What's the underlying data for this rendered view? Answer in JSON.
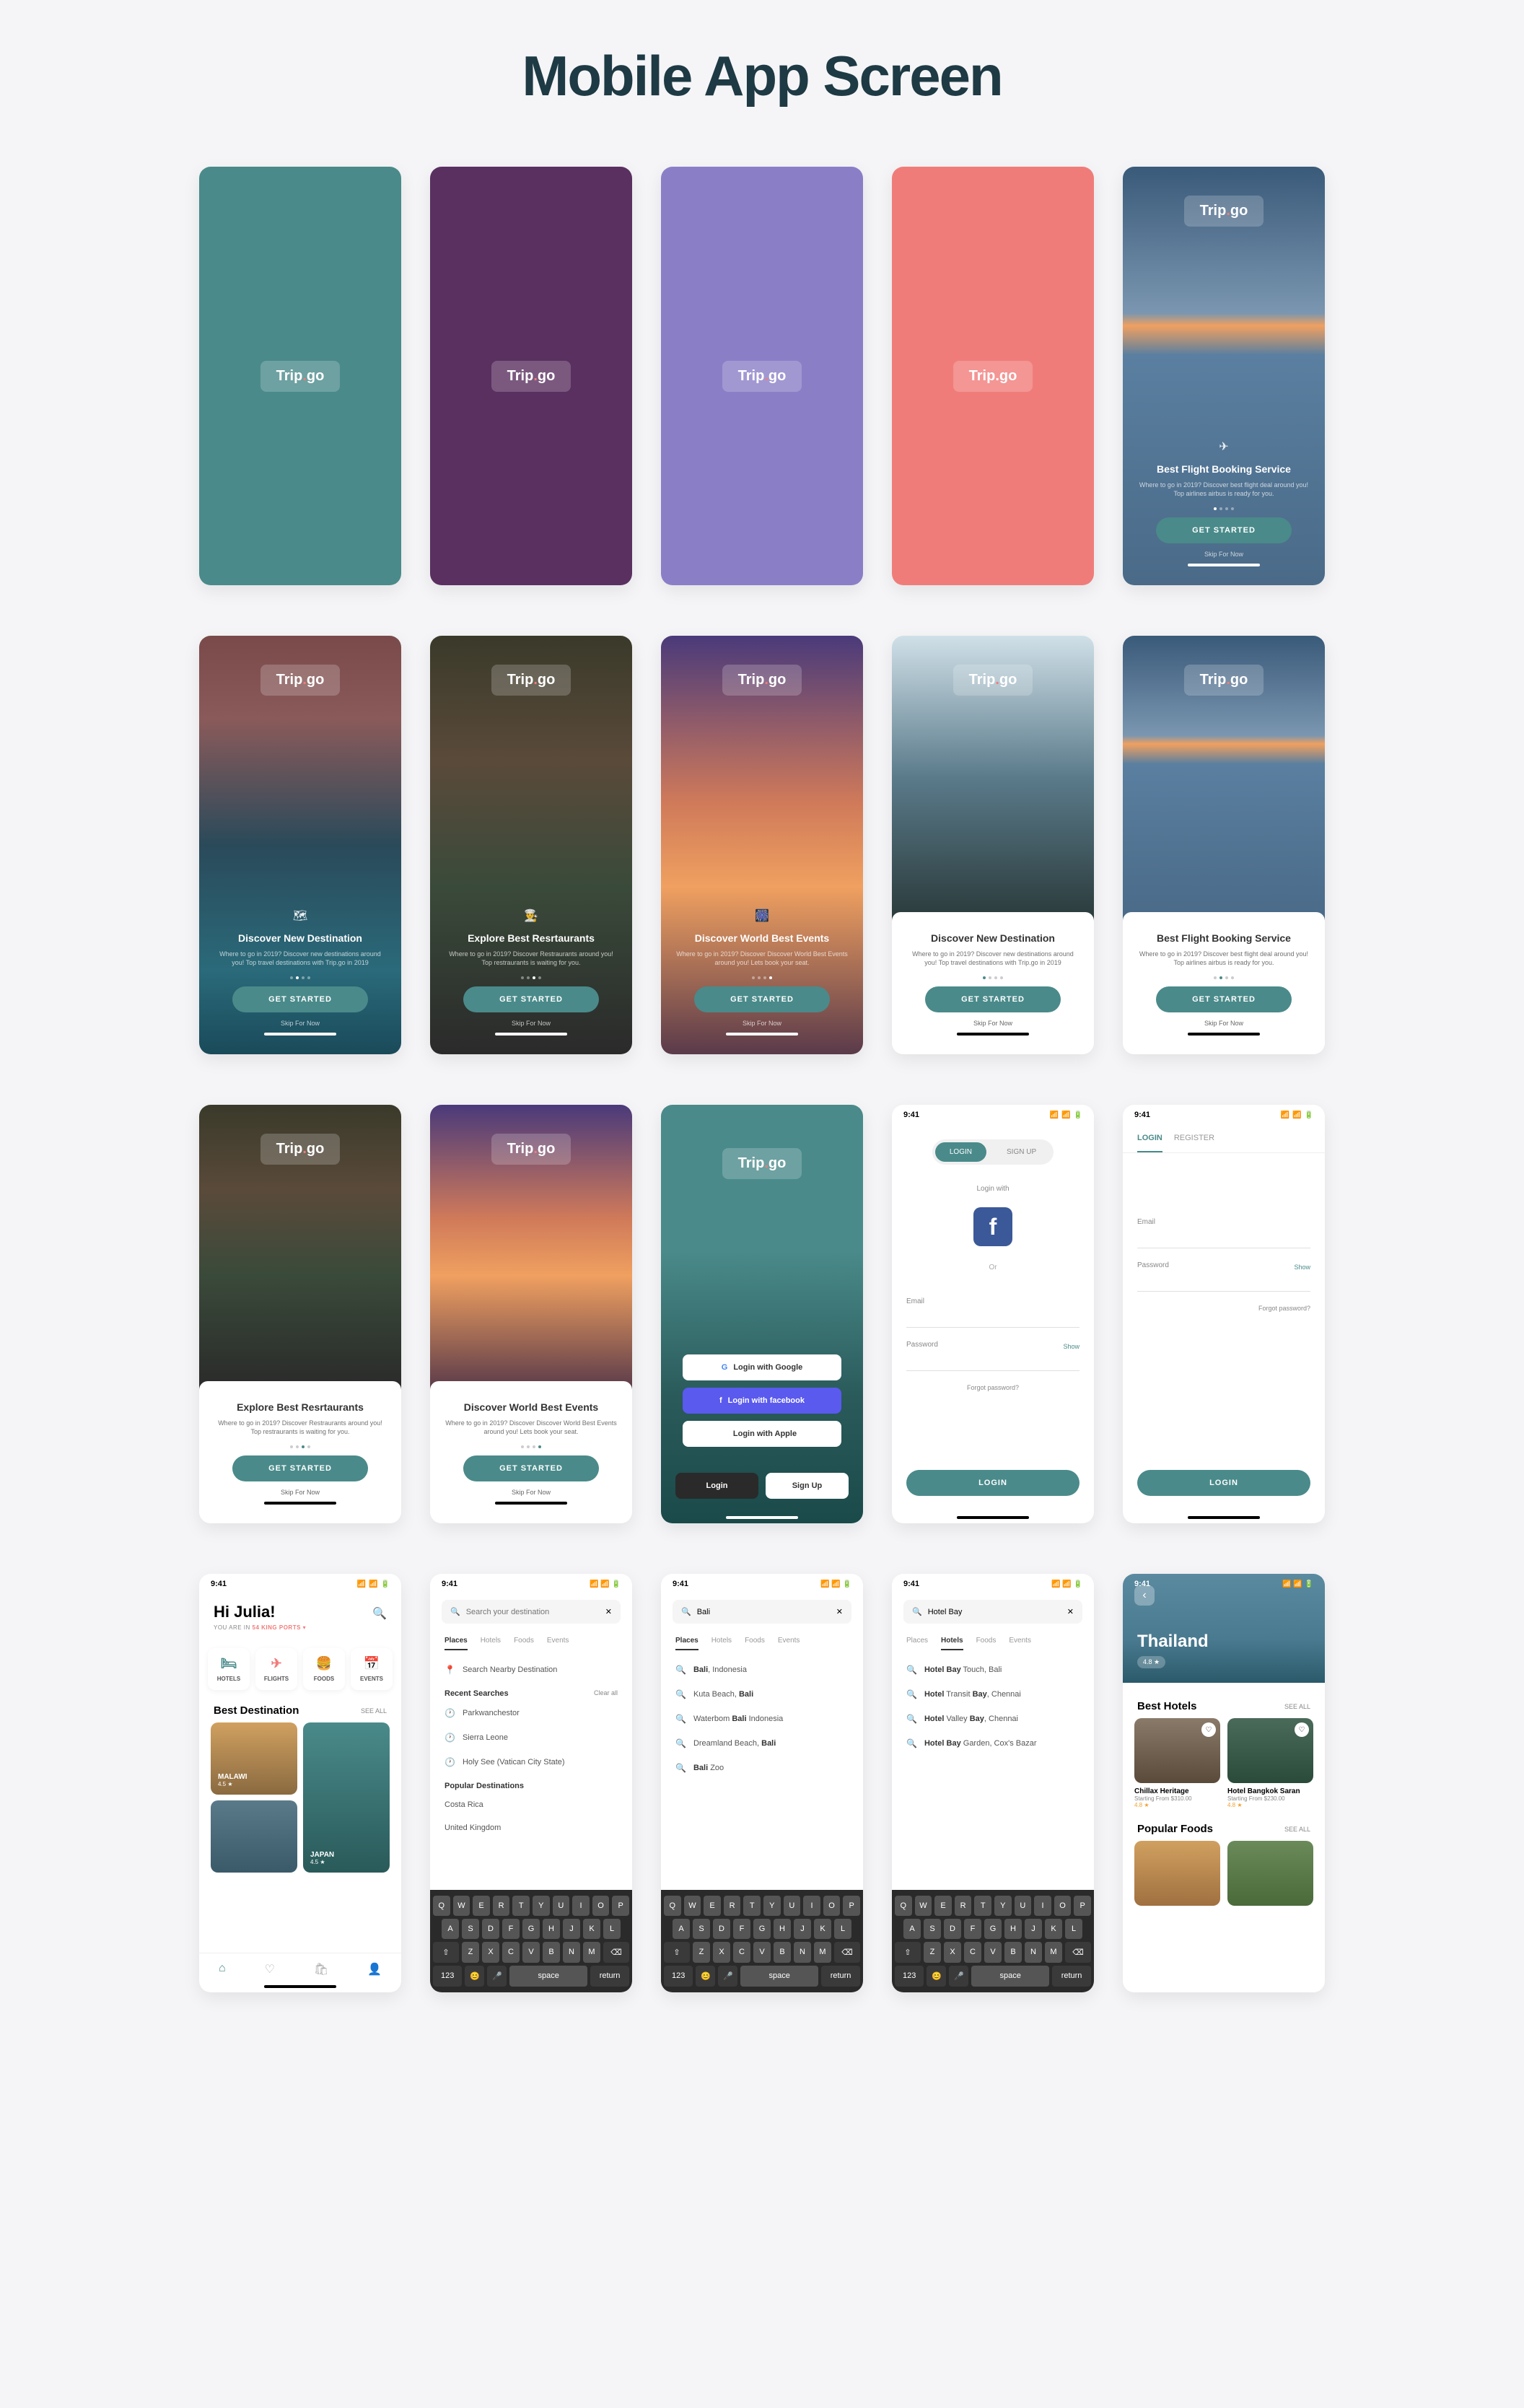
{
  "page_title": "Mobile App Screen",
  "logo": "Trip go",
  "status": {
    "time": "9:41",
    "signal": "●●●●",
    "wifi": "≋",
    "battery": "▮"
  },
  "colors": {
    "teal": "#4a8a8a",
    "coral": "#f07c7a",
    "purple": "#5a3060",
    "violet": "#8a7fc7",
    "fb": "#3b5998"
  },
  "onboarding": {
    "get_started": "GET STARTED",
    "skip": "Skip For Now",
    "flight": {
      "title": "Best Flight Booking Service",
      "desc": "Where to go in 2019? Discover best flight deal around you! Top airlines airbus is ready for you."
    },
    "dest": {
      "title": "Discover New Destination",
      "desc": "Where to go in 2019? Discover new destinations around you! Top travel destinations with Trip.go in 2019"
    },
    "rest": {
      "title": "Explore Best Resrtaurants",
      "desc": "Where to go in 2019? Discover Restraurants around you! Top restraurants is waiting for you."
    },
    "event": {
      "title": "Discover World Best Events",
      "desc": "Where to go in 2019? Discover Discover World Best Events around you! Lets book your seat."
    }
  },
  "social": {
    "google": "Login with Google",
    "facebook": "Login with facebook",
    "apple": "Login with Apple",
    "login": "Login",
    "signup": "Sign Up"
  },
  "auth": {
    "login_tab": "LOGIN",
    "signup_tab": "SIGN UP",
    "register_tab": "REGISTER",
    "login_with": "Login with",
    "or": "Or",
    "email": "Email",
    "password": "Password",
    "show": "Show",
    "forgot1": "Forgot password?",
    "forgot2": "Forgot password?",
    "login_btn": "LOGIN"
  },
  "home": {
    "greeting": "Hi Julia!",
    "you_are_in": "YOU ARE IN",
    "location": "54 KING PORTS",
    "cats": {
      "hotels": "HOTELS",
      "flights": "FLIGHTS",
      "foods": "FOODS",
      "events": "EVENTS"
    },
    "best_dest": "Best Destination",
    "see_all": "SEE ALL",
    "dest1": {
      "name": "MALAWI",
      "rate": "4.5 ★"
    },
    "dest2": {
      "name": "JAPAN",
      "rate": "4.5 ★"
    }
  },
  "search": {
    "placeholder": "Search your destination",
    "bali_query": "Bali",
    "hotel_query": "Hotel Bay",
    "tabs": {
      "places": "Places",
      "hotels": "Hotels",
      "foods": "Foods",
      "events": "Events"
    },
    "nearby": "Search Nearby Destination",
    "recent": "Recent Searches",
    "clear": "Clear all",
    "recents": [
      "Parkwanchestor",
      "Sierra Leone",
      "Holy See (Vatican City State)"
    ],
    "popular": "Popular Destinations",
    "populars": [
      "Costa Rica",
      "United Kingdom"
    ],
    "bali_results": [
      "Bali, Indonesia",
      "Kuta Beach, Bali",
      "Waterbom Bali Indonesia",
      "Dreamland Beach, Bali",
      "Bali Zoo"
    ],
    "bali_bold": [
      "Bali",
      "Bali",
      "Bali",
      "Bali",
      "Bali"
    ],
    "hotel_results": [
      {
        "text": "Hotel Bay Touch, Bali",
        "bold": "Hotel Bay"
      },
      {
        "text": "Hotel Bay Transit, Chennai",
        "bold": ""
      },
      {
        "text": "Hotel Valley Bay, Chennai",
        "bold": ""
      },
      {
        "text": "Hotel Bay Garden, Cox's Bazar",
        "bold": "Hotel Bay"
      }
    ]
  },
  "thailand": {
    "name": "Thailand",
    "rate": "4.8 ★",
    "best_hotels": "Best Hotels",
    "hotels": [
      {
        "name": "Chillax Heritage",
        "price": "Starting From $310.00",
        "stars": "4.8 ★"
      },
      {
        "name": "Hotel Bangkok Saran",
        "price": "Starting From $230.00",
        "stars": "4.8 ★"
      }
    ],
    "popular_foods": "Popular Foods"
  },
  "kbd": {
    "r1": [
      "Q",
      "W",
      "E",
      "R",
      "T",
      "Y",
      "U",
      "I",
      "O",
      "P"
    ],
    "r2": [
      "A",
      "S",
      "D",
      "F",
      "G",
      "H",
      "J",
      "K",
      "L"
    ],
    "r3_shift": "⇧",
    "r3": [
      "Z",
      "X",
      "C",
      "V",
      "B",
      "N",
      "M"
    ],
    "r3_del": "⌫",
    "r4": {
      "num": "123",
      "emoji": "😊",
      "mic": "🎤",
      "space": "space",
      "return": "return"
    }
  }
}
